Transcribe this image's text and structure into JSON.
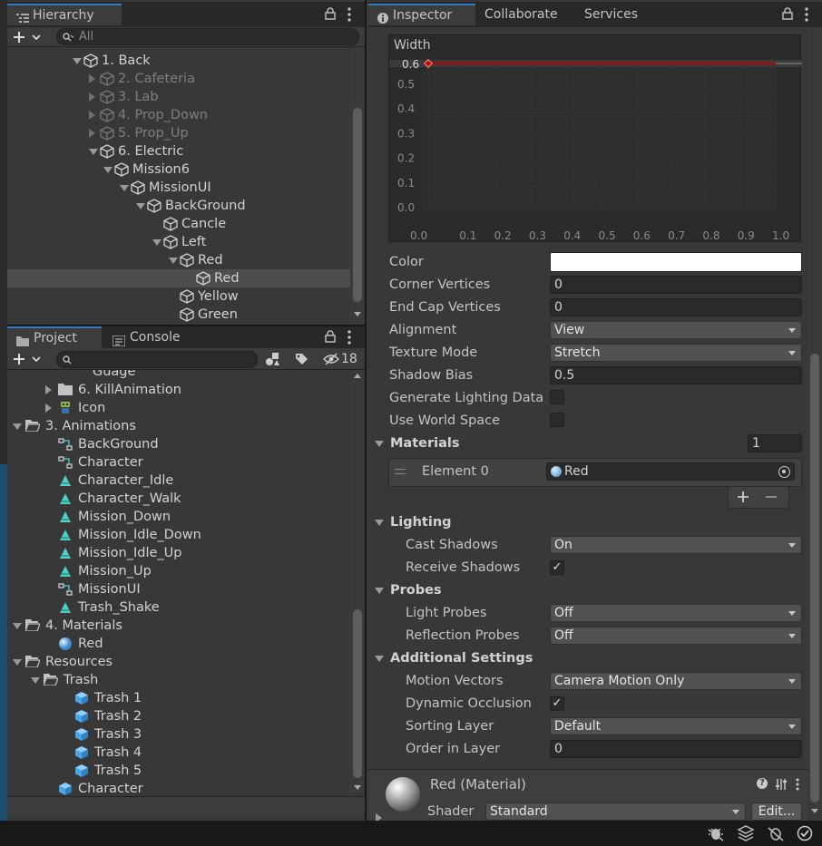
{
  "hierarchy": {
    "tab": "Hierarchy",
    "search_placeholder": "All",
    "items": [
      {
        "label": "1. Back",
        "dim": false
      },
      {
        "label": "2. Cafeteria",
        "dim": true
      },
      {
        "label": "3. Lab",
        "dim": true
      },
      {
        "label": "4. Prop_Down",
        "dim": true
      },
      {
        "label": "5. Prop_Up",
        "dim": true
      },
      {
        "label": "6. Electric",
        "dim": false
      },
      {
        "label": "Mission6",
        "dim": false
      },
      {
        "label": "MissionUI",
        "dim": false
      },
      {
        "label": "BackGround",
        "dim": false
      },
      {
        "label": "Cancle",
        "dim": false
      },
      {
        "label": "Left",
        "dim": false
      },
      {
        "label": "Red",
        "dim": false
      },
      {
        "label": "Red",
        "dim": false
      },
      {
        "label": "Yellow",
        "dim": false
      },
      {
        "label": "Green",
        "dim": false
      }
    ]
  },
  "project": {
    "tabs": [
      "Project",
      "Console"
    ],
    "hidden_count": "18",
    "items": [
      {
        "label": "Guage"
      },
      {
        "label": "6. KillAnimation"
      },
      {
        "label": "Icon"
      },
      {
        "label": "3. Animations"
      },
      {
        "label": "BackGround"
      },
      {
        "label": "Character"
      },
      {
        "label": "Character_Idle"
      },
      {
        "label": "Character_Walk"
      },
      {
        "label": "Mission_Down"
      },
      {
        "label": "Mission_Idle_Down"
      },
      {
        "label": "Mission_Idle_Up"
      },
      {
        "label": "Mission_Up"
      },
      {
        "label": "MissionUI"
      },
      {
        "label": "Trash_Shake"
      },
      {
        "label": "4. Materials"
      },
      {
        "label": "Red"
      },
      {
        "label": "Resources"
      },
      {
        "label": "Trash"
      },
      {
        "label": "Trash 1"
      },
      {
        "label": "Trash 2"
      },
      {
        "label": "Trash 3"
      },
      {
        "label": "Trash 4"
      },
      {
        "label": "Trash 5"
      },
      {
        "label": "Character"
      }
    ]
  },
  "inspector": {
    "tabs": [
      "Inspector",
      "Collaborate",
      "Services"
    ],
    "curve": {
      "title": "Width",
      "value_label": "0.6",
      "y_ticks": [
        "0.5",
        "0.4",
        "0.3",
        "0.2",
        "0.1",
        "0.0"
      ],
      "x_ticks": [
        "0.0",
        "0.1",
        "0.2",
        "0.3",
        "0.4",
        "0.5",
        "0.6",
        "0.7",
        "0.8",
        "0.9",
        "1.0"
      ]
    },
    "color_label": "Color",
    "corner_vertices": {
      "label": "Corner Vertices",
      "value": "0"
    },
    "end_cap_vertices": {
      "label": "End Cap Vertices",
      "value": "0"
    },
    "alignment": {
      "label": "Alignment",
      "value": "View"
    },
    "texture_mode": {
      "label": "Texture Mode",
      "value": "Stretch"
    },
    "shadow_bias": {
      "label": "Shadow Bias",
      "value": "0.5"
    },
    "gen_lighting": {
      "label": "Generate Lighting Data"
    },
    "world_space": {
      "label": "Use World Space"
    },
    "materials": {
      "label": "Materials",
      "count": "1",
      "element_label": "Element 0",
      "element_value": "Red"
    },
    "lighting": {
      "label": "Lighting",
      "cast_label": "Cast Shadows",
      "cast_value": "On",
      "receive_label": "Receive Shadows"
    },
    "probes": {
      "label": "Probes",
      "light_label": "Light Probes",
      "light_value": "Off",
      "refl_label": "Reflection Probes",
      "refl_value": "Off"
    },
    "additional": {
      "label": "Additional Settings",
      "motion_label": "Motion Vectors",
      "motion_value": "Camera Motion Only",
      "occl_label": "Dynamic Occlusion",
      "sort_label": "Sorting Layer",
      "sort_value": "Default",
      "order_label": "Order in Layer",
      "order_value": "0"
    },
    "material_footer": {
      "name": "Red (Material)",
      "shader_label": "Shader",
      "shader_value": "Standard",
      "edit_label": "Edit..."
    }
  },
  "colors": {
    "accent": "#3a79bb",
    "curve": "#c00000",
    "panel": "#383838",
    "header": "#3c3c3c"
  }
}
